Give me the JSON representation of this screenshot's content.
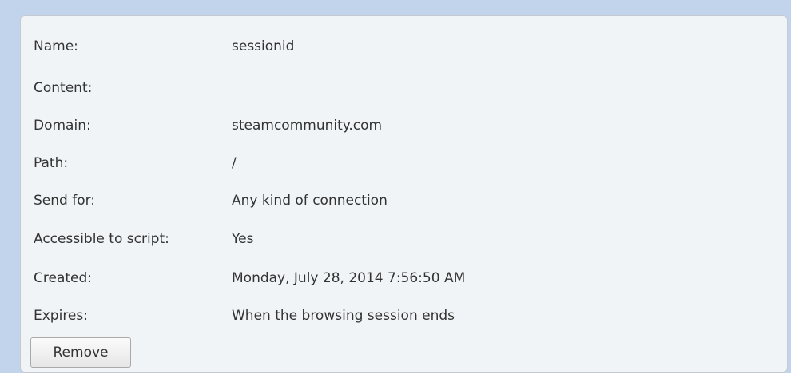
{
  "cookie_details": {
    "rows": [
      {
        "label": "Name:",
        "value": "sessionid"
      },
      {
        "label": "Content:",
        "value": ""
      },
      {
        "label": "Domain:",
        "value": "steamcommunity.com"
      },
      {
        "label": "Path:",
        "value": "/"
      },
      {
        "label": "Send for:",
        "value": "Any kind of connection"
      },
      {
        "label": "Accessible to script:",
        "value": "Yes"
      },
      {
        "label": "Created:",
        "value": "Monday, July 28, 2014 7:56:50 AM"
      },
      {
        "label": "Expires:",
        "value": "When the browsing session ends"
      }
    ],
    "remove_label": "Remove"
  }
}
